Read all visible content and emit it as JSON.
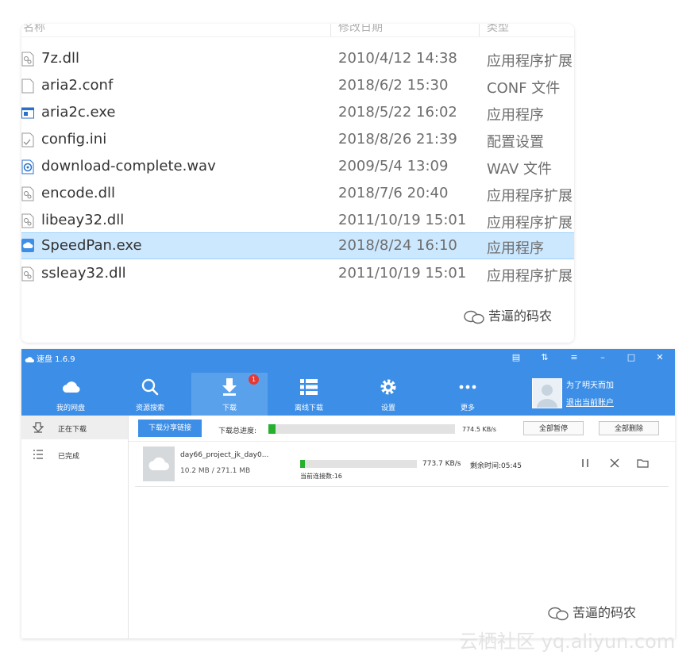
{
  "explorer": {
    "columns": [
      "名称",
      "修改日期",
      "类型"
    ],
    "files": [
      {
        "name": "7z.dll",
        "date": "2010/4/12 14:38",
        "type": "应用程序扩展",
        "icon": "dll-file-icon"
      },
      {
        "name": "aria2.conf",
        "date": "2018/6/2 15:30",
        "type": "CONF 文件",
        "icon": "blank-file-icon"
      },
      {
        "name": "aria2c.exe",
        "date": "2018/5/22 16:02",
        "type": "应用程序",
        "icon": "exe-window-icon"
      },
      {
        "name": "config.ini",
        "date": "2018/8/26 21:39",
        "type": "配置设置",
        "icon": "ini-file-icon"
      },
      {
        "name": "download-complete.wav",
        "date": "2009/5/4 13:09",
        "type": "WAV 文件",
        "icon": "audio-file-icon"
      },
      {
        "name": "encode.dll",
        "date": "2018/7/6 20:40",
        "type": "应用程序扩展",
        "icon": "dll-file-icon"
      },
      {
        "name": "libeay32.dll",
        "date": "2011/10/19 15:01",
        "type": "应用程序扩展",
        "icon": "dll-file-icon"
      },
      {
        "name": "SpeedPan.exe",
        "date": "2018/8/24 16:10",
        "type": "应用程序",
        "icon": "cloud-app-icon",
        "selected": true
      },
      {
        "name": "ssleay32.dll",
        "date": "2011/10/19 15:01",
        "type": "应用程序扩展",
        "icon": "dll-file-icon"
      }
    ],
    "watermark": "苦逼的码农"
  },
  "app": {
    "title": "速盘 1.6.9",
    "nav": [
      {
        "label": "我的网盘",
        "icon": "cloud-icon"
      },
      {
        "label": "资源搜索",
        "icon": "search-icon"
      },
      {
        "label": "下载",
        "icon": "download-icon",
        "active": true,
        "badge": "1"
      },
      {
        "label": "离线下载",
        "icon": "list-icon"
      },
      {
        "label": "设置",
        "icon": "gear-icon"
      },
      {
        "label": "更多",
        "icon": "more-dots-icon"
      }
    ],
    "user": {
      "name": "为了明天而加",
      "logout": "退出当前账户"
    },
    "sidebar": [
      {
        "label": "正在下载",
        "icon": "downloading-icon",
        "active": true
      },
      {
        "label": "已完成",
        "icon": "completed-list-icon"
      }
    ],
    "toolbar": {
      "share_label": "下载分享链接",
      "total_label": "下载总进度:",
      "total_progress": 0.04,
      "total_speed": "774.5 KB/s",
      "pause_all": "全部暂停",
      "delete_all": "全部删除"
    },
    "download": {
      "name": "day66_project_jk_day0...",
      "size": "10.2 MB / 271.1 MB",
      "progress": 0.038,
      "speed": "773.7 KB/s",
      "remaining": "剩余时间:05:45",
      "connections": "当前连接数:16"
    },
    "watermark": "苦逼的码农"
  },
  "site_watermark": "云栖社区 yq.aliyun.com",
  "colors": {
    "accent": "#3d8ee6",
    "progress": "#27b02d",
    "selection": "#cce8ff"
  }
}
